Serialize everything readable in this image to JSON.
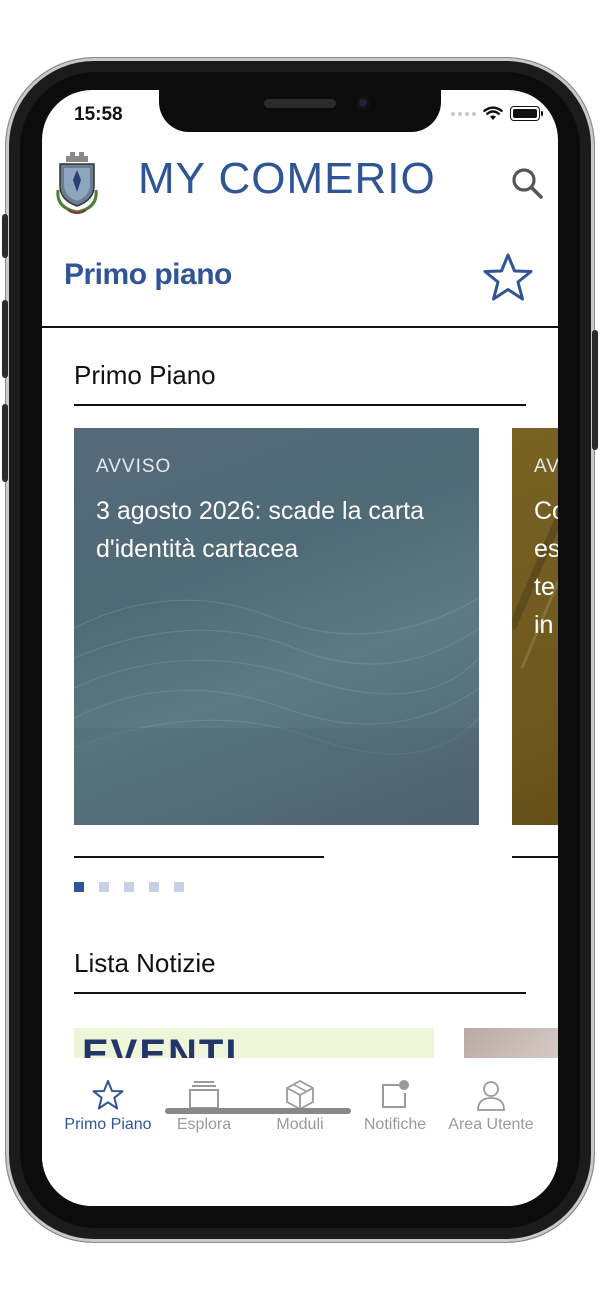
{
  "status_bar": {
    "time": "15:58"
  },
  "header": {
    "app_name_my": "MY",
    "app_name_rest": "COMERIO"
  },
  "page": {
    "title": "Primo piano"
  },
  "featured": {
    "section_title": "Primo Piano",
    "cards": [
      {
        "kind": "AVVISO",
        "headline": "3 agosto 2026: scade la carta d'identità cartacea"
      },
      {
        "kind": "AV",
        "headline": "Co es te in"
      }
    ],
    "pager": {
      "count": 5,
      "active": 1
    }
  },
  "news": {
    "section_title": "Lista Notizie",
    "items": [
      {
        "thumb_text": "EVENTI COMERIO"
      }
    ]
  },
  "tabbar": {
    "tabs": [
      {
        "label": "Primo Piano",
        "icon": "star-icon",
        "active": true
      },
      {
        "label": "Esplora",
        "icon": "layers-icon",
        "active": false
      },
      {
        "label": "Moduli",
        "icon": "cube-icon",
        "active": false
      },
      {
        "label": "Notifiche",
        "icon": "notification-icon",
        "active": false
      },
      {
        "label": "Area Utente",
        "icon": "user-icon",
        "active": false
      }
    ]
  },
  "colors": {
    "brand": "#2f5597",
    "inactive": "#9a9a9a",
    "pager_inactive": "#c7d1e3"
  }
}
